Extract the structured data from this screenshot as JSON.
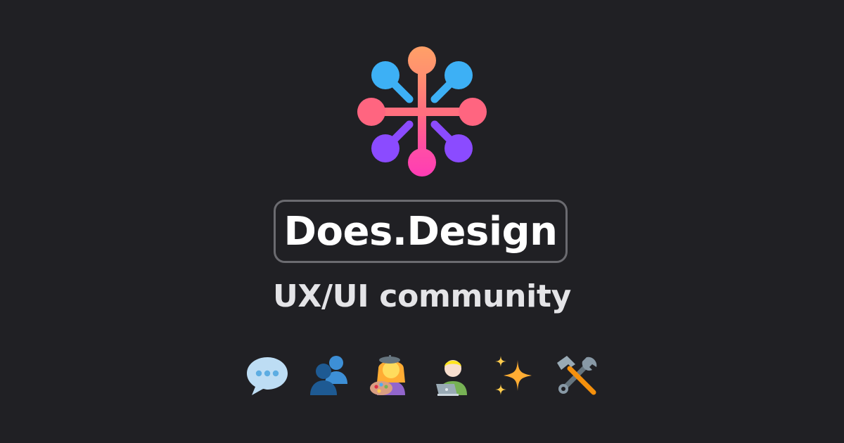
{
  "brand": {
    "name": "Does.Design",
    "tagline": "UX/UI community",
    "logo_icon": "network-node-icon",
    "colors": {
      "background": "#202024",
      "orange": "#FFA067",
      "blue": "#3DB0F5",
      "pink": "#FF5F8E",
      "magenta": "#FF3CB4",
      "purple": "#8B4BFF"
    }
  },
  "emojis": [
    {
      "icon": "speech-bubble-icon"
    },
    {
      "icon": "busts-in-silhouette-icon"
    },
    {
      "icon": "artist-icon"
    },
    {
      "icon": "technologist-icon"
    },
    {
      "icon": "sparkles-icon"
    },
    {
      "icon": "hammer-and-wrench-icon"
    }
  ]
}
